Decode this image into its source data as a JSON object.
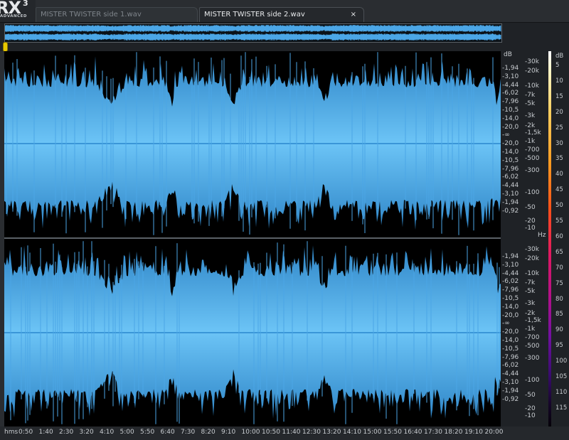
{
  "app": {
    "logo_text": "RX",
    "logo_version": "3",
    "logo_edition": "ADVANCED"
  },
  "tabs": [
    {
      "label": "MISTER TWISTER side 1.wav",
      "active": false
    },
    {
      "label": "MISTER TWISTER side 2.wav",
      "active": true,
      "close": "×"
    }
  ],
  "colors": {
    "waveform": "#4ba6e6",
    "waveform_light": "#6cc4f6",
    "background": "#000000",
    "marker": "#e8c800"
  },
  "db_scale": {
    "unit": "dB",
    "ch1": [
      "-1,94",
      "-3,10",
      "-4,44",
      "-6,02",
      "-7,96",
      "-10,5",
      "-14,0",
      "-20,0",
      "-∞",
      "-20,0",
      "-14,0",
      "-10,5",
      "-7,96",
      "-6,02",
      "-4,44",
      "-3,10",
      "-1,94",
      "-0,92"
    ],
    "ch2": [
      "-1,94",
      "-3,10",
      "-4,44",
      "-6,02",
      "-7,96",
      "-10,5",
      "-14,0",
      "-20,0",
      "-∞",
      "-20,0",
      "-14,0",
      "-10,5",
      "-7,96",
      "-6,02",
      "-4,44",
      "-3,10",
      "-1,94",
      "-0,92"
    ]
  },
  "hz_scale": {
    "unit": "Hz",
    "ch1": [
      "-30k",
      "-20k",
      "-10k",
      "-7k",
      "-5k",
      "-3k",
      "-2k",
      "-1,5k",
      "-1k",
      "-700",
      "-500",
      "-300",
      "-100",
      "-50",
      "-20",
      "-10"
    ],
    "ch2": [
      "-30k",
      "-20k",
      "-10k",
      "-7k",
      "-5k",
      "-3k",
      "-2k",
      "-1,5k",
      "-1k",
      "-700",
      "-500",
      "-300",
      "-100",
      "-50",
      "-20",
      "-10"
    ]
  },
  "colorbar": {
    "unit": "dB",
    "labels": [
      "5",
      "10",
      "15",
      "20",
      "25",
      "30",
      "35",
      "40",
      "45",
      "50",
      "55",
      "60",
      "65",
      "70",
      "75",
      "80",
      "85",
      "90",
      "95",
      "100",
      "105",
      "110",
      "115"
    ]
  },
  "time_axis": {
    "unit": "hms",
    "labels": [
      "0:50",
      "1:40",
      "2:30",
      "3:20",
      "4:10",
      "5:00",
      "5:50",
      "6:40",
      "7:30",
      "8:20",
      "9:10",
      "10:00",
      "10:50",
      "11:40",
      "12:30",
      "13:20",
      "14:10",
      "15:00",
      "15:50",
      "16:40",
      "17:30",
      "18:20",
      "19:10",
      "20:00"
    ]
  }
}
